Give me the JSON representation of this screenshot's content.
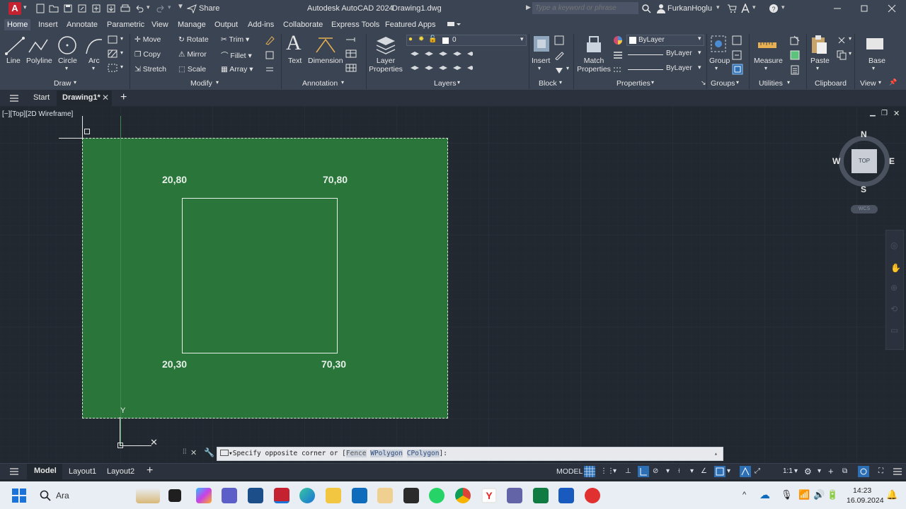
{
  "app": {
    "title": "Autodesk AutoCAD 2024",
    "file": "Drawing1.dwg",
    "share_label": "Share",
    "search_placeholder": "Type a keyword or phrase",
    "user": "FurkanHoglu",
    "logo_letter": "A"
  },
  "ribbon_tabs": [
    "Home",
    "Insert",
    "Annotate",
    "Parametric",
    "View",
    "Manage",
    "Output",
    "Add-ins",
    "Collaborate",
    "Express Tools",
    "Featured Apps"
  ],
  "ribbon": {
    "draw": {
      "line": "Line",
      "polyline": "Polyline",
      "circle": "Circle",
      "arc": "Arc",
      "group": "Draw"
    },
    "modify": {
      "move": "Move",
      "rotate": "Rotate",
      "trim": "Trim",
      "copy": "Copy",
      "mirror": "Mirror",
      "fillet": "Fillet",
      "stretch": "Stretch",
      "scale": "Scale",
      "array": "Array",
      "group": "Modify"
    },
    "annotation": {
      "text": "Text",
      "dimension": "Dimension",
      "group": "Annotation"
    },
    "layers": {
      "properties": "Layer Properties",
      "current": "0",
      "group": "Layers"
    },
    "block": {
      "insert": "Insert",
      "group": "Block"
    },
    "properties": {
      "match": "Match Properties",
      "color": "ByLayer",
      "linetype": "ByLayer",
      "lineweight": "ByLayer",
      "group": "Properties"
    },
    "groups": {
      "group_btn": "Group",
      "group": "Groups"
    },
    "utilities": {
      "measure": "Measure",
      "group": "Utilities"
    },
    "clipboard": {
      "paste": "Paste",
      "group": "Clipboard"
    },
    "view": {
      "base": "Base",
      "group": "View"
    }
  },
  "doc_tabs": {
    "start": "Start",
    "drawing": "Drawing1*"
  },
  "viewport": {
    "label": "[−][Top][2D Wireframe]",
    "coords": {
      "top_left": "20,80",
      "top_right": "70,80",
      "bottom_left": "20,30",
      "bottom_right": "70,30"
    },
    "viewcube": {
      "n": "N",
      "s": "S",
      "e": "E",
      "w": "W",
      "top": "TOP",
      "wcs": "WCS"
    },
    "ucs_y": "Y"
  },
  "command_line": {
    "prompt": "Specify opposite corner or [",
    "opt1": "Fence",
    "opt2": "WPolygon",
    "opt3": "CPolygon",
    "end": "]:"
  },
  "layout_tabs": {
    "model": "Model",
    "layout1": "Layout1",
    "layout2": "Layout2"
  },
  "status": {
    "model": "MODEL",
    "scale": "1:1"
  },
  "taskbar": {
    "search": "Ara",
    "time": "14:23",
    "date": "16.09.2024"
  },
  "colors": {
    "accent": "#c42230",
    "selection": "#2b7a3b",
    "bg": "#212830",
    "ribbon": "#3b4453"
  }
}
